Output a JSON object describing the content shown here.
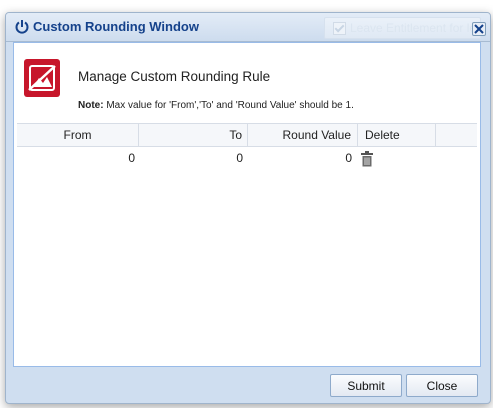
{
  "window": {
    "title": "Custom Rounding Window",
    "background_checkbox_label": "Leave Entitlement for le"
  },
  "content": {
    "heading": "Manage Custom Rounding Rule",
    "note_label": "Note:",
    "note_text": " Max value for 'From','To' and 'Round Value' should be 1."
  },
  "grid": {
    "columns": [
      "From",
      "To",
      "Round Value",
      "Delete"
    ],
    "rows": [
      {
        "from": "0",
        "to": "0",
        "round_value": "0"
      }
    ]
  },
  "footer": {
    "submit_label": "Submit",
    "close_label": "Close"
  },
  "icons": {
    "title": "power-icon",
    "window_close": "close-icon",
    "rule": "no-image-icon",
    "row_delete": "trash-icon"
  },
  "colors": {
    "title_text": "#15428b",
    "frame": "#cfdef0",
    "icon_red": "#c7162b"
  }
}
